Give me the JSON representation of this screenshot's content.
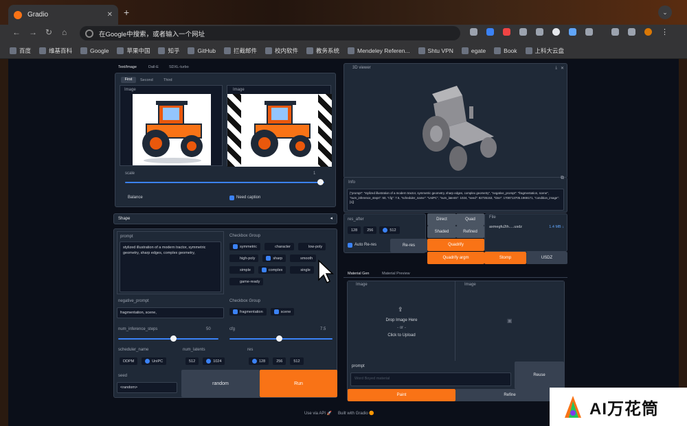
{
  "browser": {
    "tab_title": "Gradio",
    "new_tab": "+",
    "address": "在Google中搜索，或者输入一个网址",
    "bookmarks": [
      "百度",
      "维基百科",
      "Google",
      "苹果中国",
      "知乎",
      "GitHub",
      "拦截邮件",
      "校内软件",
      "教务系统",
      "Mendeley Referen...",
      "Shtu VPN",
      "egate",
      "Book",
      "上科大云盘"
    ]
  },
  "left": {
    "tabs": [
      "Text/Image",
      "Dall-E",
      "SDXL-turbo"
    ],
    "subtabs": [
      "First",
      "Second",
      "Third"
    ],
    "image_label": "Image",
    "scale_label": "scale",
    "scale_value": "1",
    "scale_fraction": 0.98,
    "balance": "Balance",
    "need_caption": "Need caption",
    "shape": "Shape",
    "prompt_label": "prompt",
    "prompt_text": "stylized illustration of a modern tractor, symmetric geometry, sharp edges, complex geometry,",
    "checkbox_group": "Checkbox Group",
    "checks1": [
      {
        "t": "symmetric",
        "on": true
      },
      {
        "t": "character",
        "on": false
      },
      {
        "t": "low-poly",
        "on": false
      },
      {
        "t": "high-poly",
        "on": false
      },
      {
        "t": "sharp",
        "on": true
      },
      {
        "t": "smooth",
        "on": false
      },
      {
        "t": "simple",
        "on": false
      },
      {
        "t": "complex",
        "on": true
      },
      {
        "t": "single",
        "on": false
      },
      {
        "t": "game-ready",
        "on": false
      }
    ],
    "neg_label": "negative_prompt",
    "neg_text": "fragmentation, scene,",
    "checks2": [
      {
        "t": "fragmentation",
        "on": true
      },
      {
        "t": "scene",
        "on": true
      }
    ],
    "steps_label": "num_inference_steps",
    "steps_value": "50",
    "steps_fraction": 0.55,
    "cfg_label": "cfg",
    "cfg_value": "7.5",
    "cfg_fraction": 0.48,
    "sched_label": "scheduler_name",
    "sched": [
      {
        "t": "DDPM",
        "on": false
      },
      {
        "t": "UniPC",
        "on": true
      }
    ],
    "latents_label": "num_latents",
    "latents": [
      {
        "t": "512",
        "on": false
      },
      {
        "t": "1024",
        "on": true
      }
    ],
    "res_label": "res",
    "res": [
      {
        "t": "128",
        "on": true
      },
      {
        "t": "256",
        "on": false
      },
      {
        "t": "512",
        "on": false
      }
    ],
    "seed_label": "seed",
    "seed_value": "<random>",
    "random_btn": "random",
    "run_btn": "Run"
  },
  "right": {
    "viewer_label": "3D viewer",
    "info_label": "Info",
    "info_text": "{\"prompt\": \"stylized illustration of a modern tractor, symmetric geometry, sharp edges, complex geometry\", \"negative_prompt\": \"fragmentation, scene\", \"num_inference_steps\": 50, \"cfg\": 7.5, \"scheduler_name\": \"UniPC\", \"num_latents\": 1024, \"seed\": 82735153, \"time\": 1708713705.1969171, \"condition_image\": [1]}",
    "res_after_label": "res_after",
    "res_after": [
      {
        "t": "128",
        "on": false
      },
      {
        "t": "256",
        "on": false
      },
      {
        "t": "512",
        "on": true
      }
    ],
    "auto_rerun": "Auto Re-res",
    "rerun_btn": "Re-res",
    "direct": "Direct",
    "quad": "Quad",
    "shaded": "Shaded",
    "refined": "Refined",
    "quadrify": "Quadrify",
    "quadrify_argm": "Quadrify argm",
    "stomp": "Stomp",
    "usdz": "USDZ",
    "file_label": "File",
    "file_name": "axmegfu2th.....usdz",
    "file_size": "1.4 MB ↓",
    "mat_tabs": [
      "Material Gen",
      "Material Preview"
    ],
    "image_label": "Image",
    "drop_text": "Drop Image Here",
    "or_text": "- or -",
    "click_text": "Click to Upload",
    "prompt_label": "prompt",
    "prompt_placeholder": "Word Boyed material",
    "reuse_btn": "Reuse",
    "paint_btn": "Paint",
    "refine_btn": "Refine"
  },
  "footer": {
    "api": "Use via API",
    "built": "Built with Gradio"
  },
  "watermark": "AI万花筒",
  "colors": {
    "accent": "#f97316",
    "blue": "#3b82f6",
    "bg": "#0b0f19"
  }
}
